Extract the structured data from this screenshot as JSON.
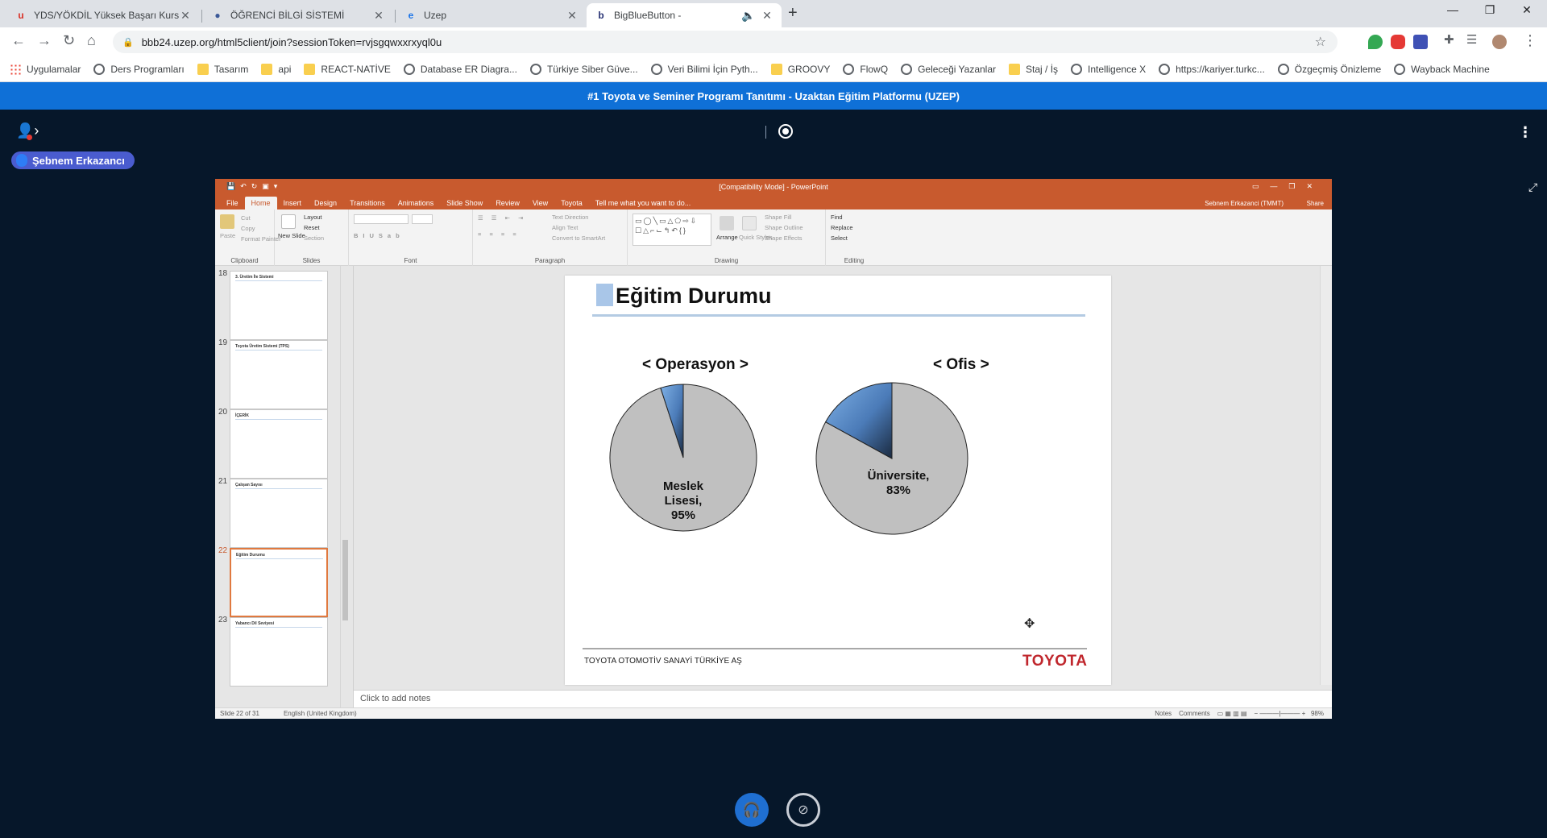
{
  "browser": {
    "tabs": [
      {
        "title": "YDS/YÖKDİL Yüksek Başarı Kursu",
        "favicon": "u",
        "favicon_color": "#d93025"
      },
      {
        "title": "ÖĞRENCİ BİLGİ SİSTEMİ",
        "favicon": "●",
        "favicon_color": "#3b5998"
      },
      {
        "title": "Uzep",
        "favicon": "e",
        "favicon_color": "#1a73e8"
      },
      {
        "title": "BigBlueButton -",
        "favicon": "b",
        "favicon_color": "#283274"
      }
    ],
    "active_tab_index": 3,
    "url": "bbb24.uzep.org/html5client/join?sessionToken=rvjsgqwxxrxyql0u",
    "bookmarks": [
      {
        "label": "Uygulamalar",
        "icon": "grid"
      },
      {
        "label": "Ders Programları",
        "icon": "globe"
      },
      {
        "label": "Tasarım",
        "icon": "folder"
      },
      {
        "label": "api",
        "icon": "folder"
      },
      {
        "label": "REACT-NATİVE",
        "icon": "folder"
      },
      {
        "label": "Database ER Diagra...",
        "icon": "globe"
      },
      {
        "label": "Türkiye Siber Güve...",
        "icon": "globe"
      },
      {
        "label": "Veri Bilimi İçin Pyth...",
        "icon": "globe"
      },
      {
        "label": "GROOVY",
        "icon": "folder"
      },
      {
        "label": "FlowQ",
        "icon": "globe"
      },
      {
        "label": "Geleceği Yazanlar",
        "icon": "globe"
      },
      {
        "label": "Staj / İş",
        "icon": "folder"
      },
      {
        "label": "Intelligence X",
        "icon": "globe"
      },
      {
        "label": "https://kariyer.turkc...",
        "icon": "globe"
      },
      {
        "label": "Özgeçmiş Önizleme",
        "icon": "globe"
      },
      {
        "label": "Wayback Machine",
        "icon": "globe"
      }
    ]
  },
  "bbb": {
    "meeting_title": "#1 Toyota ve Seminer Programı Tanıtımı - Uzaktan Eğitim Platformu (UZEP)",
    "presenter_name": "Şebnem Erkazancı"
  },
  "powerpoint": {
    "window_title": "[Compatibility Mode] - PowerPoint",
    "tabs": [
      "File",
      "Home",
      "Insert",
      "Design",
      "Transitions",
      "Animations",
      "Slide Show",
      "Review",
      "View",
      "Toyota",
      "Tell me what you want to do..."
    ],
    "active_tab": "Home",
    "user": "Sebnem Erkazanci (TMMT)",
    "share": "Share",
    "ribbon_groups": [
      "Clipboard",
      "Slides",
      "Font",
      "Paragraph",
      "Drawing",
      "Editing"
    ],
    "ribbon_items": {
      "paste": "Paste",
      "cut": "Cut",
      "copy": "Copy",
      "format_painter": "Format Painter",
      "new_slide": "New Slide",
      "layout": "Layout",
      "reset": "Reset",
      "section": "Section",
      "text_direction": "Text Direction",
      "align_text": "Align Text",
      "convert": "Convert to SmartArt",
      "arrange": "Arrange",
      "quick_styles": "Quick Styles",
      "shape_fill": "Shape Fill",
      "shape_outline": "Shape Outline",
      "shape_effects": "Shape Effects",
      "find": "Find",
      "replace": "Replace",
      "select": "Select"
    },
    "thumbnails": [
      {
        "num": "18",
        "title": "3. Üretim İle Sistemi"
      },
      {
        "num": "19",
        "title": "Toyota Üretim Sistemi (TPS)"
      },
      {
        "num": "20",
        "title": "İÇERİK"
      },
      {
        "num": "21",
        "title": "Çalışan Sayısı"
      },
      {
        "num": "22",
        "title": "Eğitim Durumu",
        "selected": true
      },
      {
        "num": "23",
        "title": "Yabancı Dil Seviyesi"
      }
    ],
    "notes_placeholder": "Click to add notes",
    "status_slide": "Slide 22 of 31",
    "status_lang": "English (United Kingdom)",
    "status_notes": "Notes",
    "status_comments": "Comments",
    "zoom": "98%"
  },
  "slide": {
    "title": "Eğitim Durumu",
    "footer_company": "TOYOTA OTOMOTİV SANAYİ TÜRKİYE AŞ",
    "footer_logo": "TOYOTA"
  },
  "chart_data": [
    {
      "type": "pie",
      "title": "< Operasyon >",
      "slices": [
        {
          "label": "Meslek Lisesi,",
          "value": 95,
          "value_label": "95%",
          "color": "#c0c0c0"
        },
        {
          "label": "",
          "value": 5,
          "value_label": "",
          "color": "#7fb1e6"
        }
      ]
    },
    {
      "type": "pie",
      "title": "< Ofis >",
      "slices": [
        {
          "label": "Üniversite,",
          "value": 83,
          "value_label": "83%",
          "color": "#c0c0c0"
        },
        {
          "label": "",
          "value": 17,
          "value_label": "",
          "color": "#7fb1e6"
        }
      ]
    }
  ]
}
